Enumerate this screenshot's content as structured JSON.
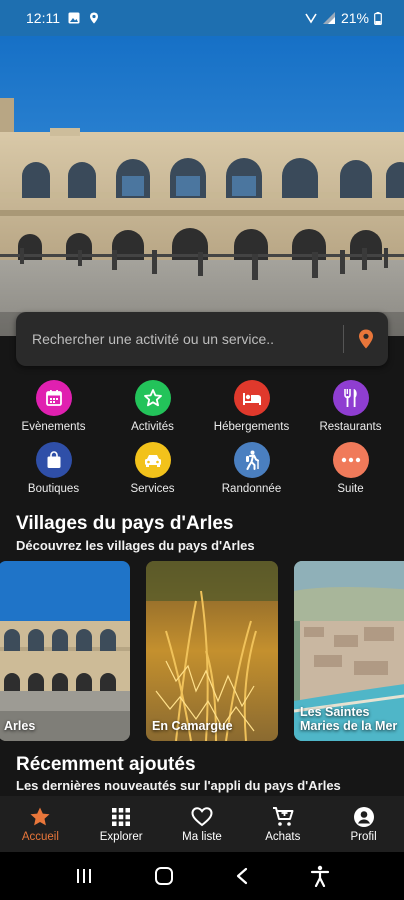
{
  "status_bar": {
    "time": "12:11",
    "battery": "21%"
  },
  "search": {
    "placeholder": "Rechercher une activité ou un service.."
  },
  "categories": [
    {
      "label": "Evènements",
      "icon": "calendar-icon",
      "color": "#e020b0"
    },
    {
      "label": "Activités",
      "icon": "star-icon",
      "color": "#23c35a"
    },
    {
      "label": "Hébergements",
      "icon": "bed-icon",
      "color": "#e0392c"
    },
    {
      "label": "Restaurants",
      "icon": "cutlery-icon",
      "color": "#8f3ed1"
    },
    {
      "label": "Boutiques",
      "icon": "shopping-bag-icon",
      "color": "#2f4fa8"
    },
    {
      "label": "Services",
      "icon": "taxi-icon",
      "color": "#f2c21b"
    },
    {
      "label": "Randonnée",
      "icon": "hiker-icon",
      "color": "#4a7fc0"
    },
    {
      "label": "Suite",
      "icon": "more-icon",
      "color": "#f07a5a"
    }
  ],
  "villages": {
    "title": "Villages du pays d'Arles",
    "subtitle": "Découvrez les villages du pays d'Arles",
    "items": [
      {
        "label": "Arles"
      },
      {
        "label": "En Camargue"
      },
      {
        "label_line1": "Les Saintes",
        "label_line2": "Maries de la Mer"
      }
    ]
  },
  "recent": {
    "title": "Récemment ajoutés",
    "subtitle": "Les dernières nouveautés sur l'appli du pays d'Arles"
  },
  "bottom_nav": [
    {
      "label": "Accueil",
      "icon": "star-icon",
      "active": true
    },
    {
      "label": "Explorer",
      "icon": "grid-icon"
    },
    {
      "label": "Ma liste",
      "icon": "heart-icon"
    },
    {
      "label": "Achats",
      "icon": "cart-icon"
    },
    {
      "label": "Profil",
      "icon": "profile-icon"
    }
  ],
  "colors": {
    "accent": "#e8763a",
    "status_bar": "#1e6fb0",
    "background": "#161616"
  }
}
